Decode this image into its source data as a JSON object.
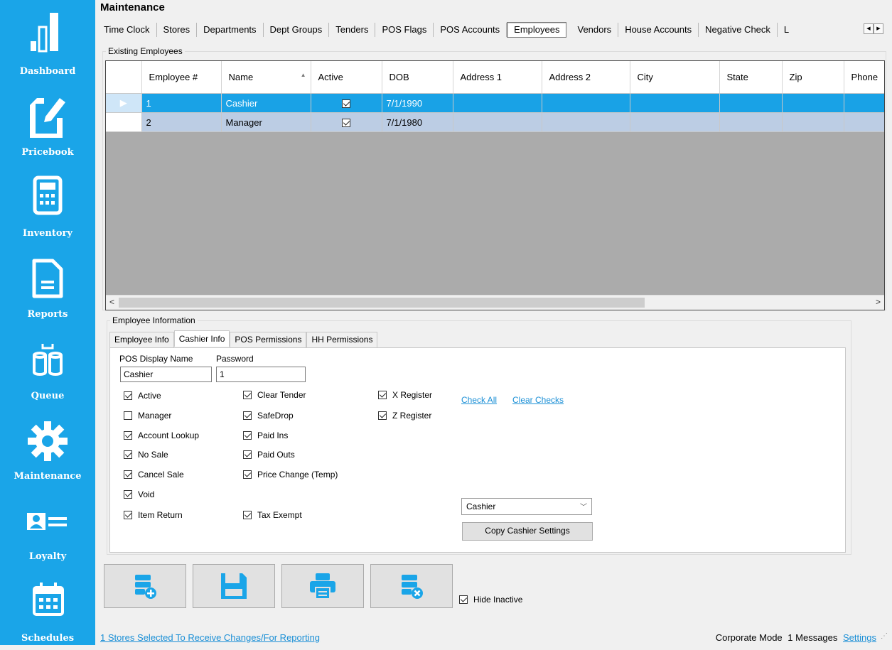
{
  "sidebar": {
    "items": [
      {
        "label": "Dashboard",
        "icon": "bar-chart-icon"
      },
      {
        "label": "Pricebook",
        "icon": "edit-document-icon"
      },
      {
        "label": "Inventory",
        "icon": "calculator-icon"
      },
      {
        "label": "Reports",
        "icon": "report-document-icon"
      },
      {
        "label": "Queue",
        "icon": "database-queue-icon"
      },
      {
        "label": "Maintenance",
        "icon": "gear-icon"
      },
      {
        "label": "Loyalty",
        "icon": "id-card-icon"
      },
      {
        "label": "Schedules",
        "icon": "calendar-icon"
      }
    ]
  },
  "page": {
    "title": "Maintenance"
  },
  "tabs": [
    "Time Clock",
    "Stores",
    "Departments",
    "Dept Groups",
    "Tenders",
    "POS Flags",
    "POS Accounts",
    "Employees",
    "Vendors",
    "House Accounts",
    "Negative Check",
    "L"
  ],
  "active_tab": "Employees",
  "employees": {
    "legend": "Existing Employees",
    "columns": [
      "Employee #",
      "Name",
      "Active",
      "DOB",
      "Address 1",
      "Address 2",
      "City",
      "State",
      "Zip",
      "Phone"
    ],
    "sorted_column": "Name",
    "rows": [
      {
        "num": "1",
        "name": "Cashier",
        "active": true,
        "dob": "7/1/1990",
        "addr1": "",
        "addr2": "",
        "city": "",
        "state": "",
        "zip": "",
        "phone": ""
      },
      {
        "num": "2",
        "name": "Manager",
        "active": true,
        "dob": "7/1/1980",
        "addr1": "",
        "addr2": "",
        "city": "",
        "state": "",
        "zip": "",
        "phone": ""
      }
    ]
  },
  "info": {
    "legend": "Employee Information",
    "tabs": [
      "Employee Info",
      "Cashier Info",
      "POS Permissions",
      "HH Permissions"
    ],
    "active_tab": "Cashier Info",
    "pos_display_name_label": "POS Display Name",
    "pos_display_name": "Cashier",
    "password_label": "Password",
    "password": "1",
    "perms_col1": [
      {
        "label": "Active",
        "checked": true
      },
      {
        "label": "Manager",
        "checked": false
      },
      {
        "label": "Account Lookup",
        "checked": true
      },
      {
        "label": "No Sale",
        "checked": true
      },
      {
        "label": "Cancel Sale",
        "checked": true
      },
      {
        "label": "Void",
        "checked": true
      },
      {
        "label": "Item Return",
        "checked": true
      }
    ],
    "perms_col2": [
      {
        "label": "Clear Tender",
        "checked": true
      },
      {
        "label": "SafeDrop",
        "checked": true
      },
      {
        "label": "Paid Ins",
        "checked": true
      },
      {
        "label": "Paid Outs",
        "checked": true
      },
      {
        "label": "Price Change (Temp)",
        "checked": true
      },
      {
        "label": "Tax Exempt",
        "checked": true
      }
    ],
    "perms_col3": [
      {
        "label": "X Register",
        "checked": true
      },
      {
        "label": "Z Register",
        "checked": true
      }
    ],
    "check_all": "Check All",
    "clear_checks": "Clear Checks",
    "copy_from_value": "Cashier",
    "copy_button": "Copy Cashier Settings"
  },
  "actions": {
    "buttons": [
      "add-record-icon",
      "save-icon",
      "print-icon",
      "delete-record-icon"
    ],
    "hide_inactive_label": "Hide Inactive",
    "hide_inactive_checked": true
  },
  "status": {
    "stores_link": "1 Stores Selected To Receive Changes/For Reporting",
    "mode": "Corporate Mode",
    "messages": "1 Messages",
    "settings": "Settings"
  },
  "colors": {
    "sidebar": "#1aa5e8",
    "selected_row": "#19a2e6",
    "alt_row": "#bccde4",
    "link": "#1a8fd6"
  }
}
